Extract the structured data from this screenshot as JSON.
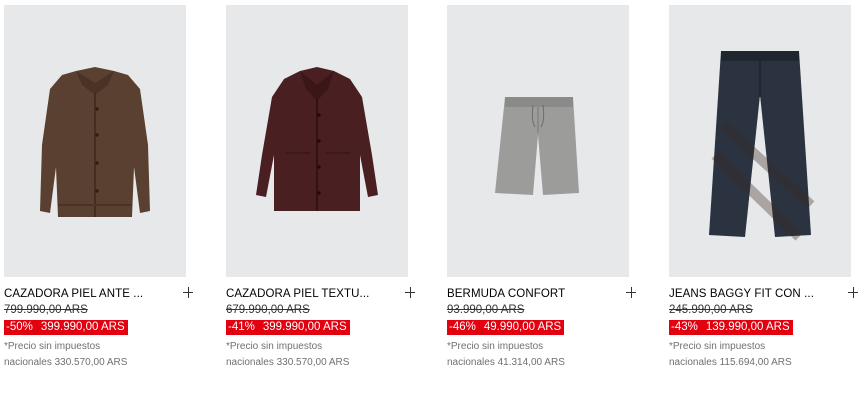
{
  "products": [
    {
      "name": "CAZADORA PIEL ANTE ...",
      "old_price": "799.990,00 ARS",
      "discount": "-50%",
      "sale_price": "399.990,00 ARS",
      "tax_note": "*Precio sin impuestos",
      "national_price": "nacionales 330.570,00 ARS",
      "image_icon": "suede-jacket"
    },
    {
      "name": "CAZADORA PIEL TEXTU...",
      "old_price": "679.990,00 ARS",
      "discount": "-41%",
      "sale_price": "399.990,00 ARS",
      "tax_note": "*Precio sin impuestos",
      "national_price": "nacionales 330.570,00 ARS",
      "image_icon": "leather-jacket"
    },
    {
      "name": "BERMUDA CONFORT",
      "old_price": "93.990,00 ARS",
      "discount": "-46%",
      "sale_price": "49.990,00 ARS",
      "tax_note": "*Precio sin impuestos",
      "national_price": "nacionales 41.314,00 ARS",
      "image_icon": "shorts"
    },
    {
      "name": "JEANS BAGGY FIT CON ...",
      "old_price": "245.990,00 ARS",
      "discount": "-43%",
      "sale_price": "139.990,00 ARS",
      "tax_note": "*Precio sin impuestos",
      "national_price": "nacionales 115.694,00 ARS",
      "image_icon": "jeans"
    }
  ],
  "colors": {
    "sale_bg": "#e3000f",
    "image_bg": "#e6e8ea"
  }
}
